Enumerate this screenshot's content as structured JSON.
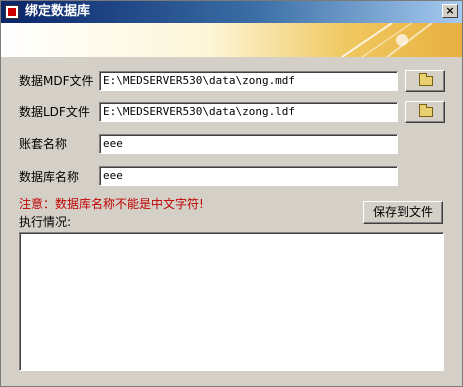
{
  "window": {
    "title": "绑定数据库",
    "close_glyph": "×"
  },
  "form": {
    "mdf_label": "数据MDF文件",
    "mdf_value": "E:\\MEDSERVER530\\data\\zong.mdf",
    "ldf_label": "数据LDF文件",
    "ldf_value": "E:\\MEDSERVER530\\data\\zong.ldf",
    "account_label": "账套名称",
    "account_value": "eee",
    "dbname_label": "数据库名称",
    "dbname_value": "eee",
    "warning": "注意：数据库名称不能是中文字符!",
    "log_label": "执行情况:",
    "save_button": "保存到文件",
    "log_text": ""
  },
  "colors": {
    "titlebar_start": "#0a246a",
    "warning": "#c00000",
    "face": "#d4d0c8"
  },
  "icons": {
    "browse": "folder-icon",
    "app": "app-icon",
    "close": "close-icon"
  }
}
